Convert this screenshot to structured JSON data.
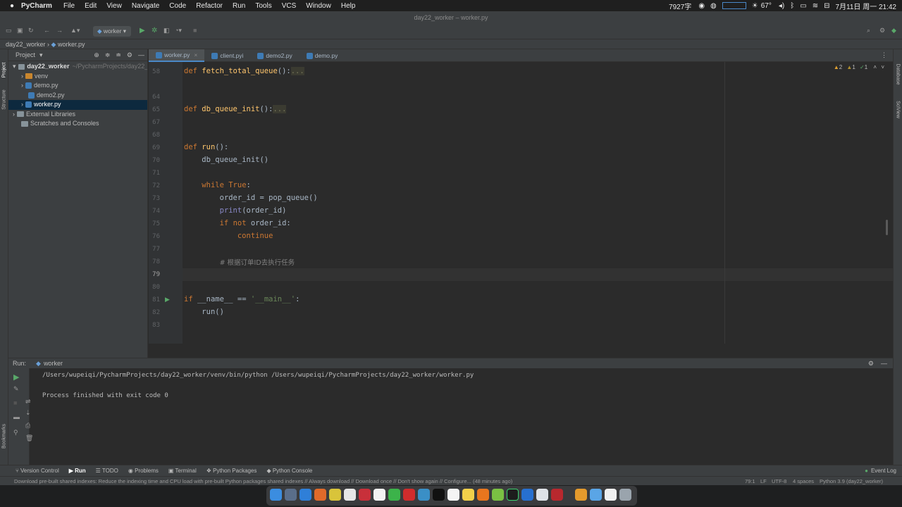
{
  "menubar": {
    "app": "PyCharm",
    "items": [
      "File",
      "Edit",
      "View",
      "Navigate",
      "Code",
      "Refactor",
      "Run",
      "Tools",
      "VCS",
      "Window",
      "Help"
    ],
    "status_count": "7927字",
    "temp": "67°",
    "datetime": "7月11日 周一 21:42"
  },
  "window": {
    "title": "day22_worker – worker.py"
  },
  "toolbar": {
    "run_config": "worker"
  },
  "nav": {
    "project": "day22_worker",
    "file": "worker.py"
  },
  "project_panel": {
    "title": "Project",
    "root": "day22_worker",
    "root_path": "~/PycharmProjects/day22_",
    "items": [
      "venv",
      "demo.py",
      "demo2.py",
      "worker.py",
      "External Libraries",
      "Scratches and Consoles"
    ]
  },
  "tabs": [
    "worker.py",
    "client.pyi",
    "demo2.py",
    "demo.py"
  ],
  "inspections": {
    "warnings": "2",
    "weak": "1",
    "typos": "1"
  },
  "code": {
    "l58": "58",
    "l64": "64",
    "l65": "65",
    "l67": "67",
    "l68": "68",
    "l69": "69",
    "l70": "70",
    "l71": "71",
    "l72": "72",
    "l73": "73",
    "l74": "74",
    "l75": "75",
    "l76": "76",
    "l77": "77",
    "l78": "78",
    "l79": "79",
    "l80": "80",
    "l81": "81",
    "l82": "82",
    "l83": "83",
    "def": "def",
    "while": "while",
    "true": "True",
    "if": "if",
    "not": "not",
    "continue": "continue",
    "eq": " == ",
    "fetch": "fetch_total_queue",
    "dbinit": "db_queue_init",
    "run": "run",
    "parens": "():",
    "dots": "...",
    "run_body": "db_queue_init()",
    "order_line": "order_id = pop_queue()",
    "print": "print",
    "print_arg": "(order_id)",
    "ifnot_arg": " order_id:",
    "comment": "# 根据订单ID去执行任务",
    "name_var": "__name__",
    "main_str": "'__main__'",
    "colon": ":",
    "run_call": "run()"
  },
  "run_panel": {
    "label": "Run:",
    "config": "worker",
    "cmd": "/Users/wupeiqi/PycharmProjects/day22_worker/venv/bin/python /Users/wupeiqi/PycharmProjects/day22_worker/worker.py",
    "result": "Process finished with exit code 0"
  },
  "bottom_tabs": [
    "Version Control",
    "Run",
    "TODO",
    "Problems",
    "Terminal",
    "Python Packages",
    "Python Console"
  ],
  "event_log": "Event Log",
  "status": {
    "message": "Download pre-built shared indexes: Reduce the indexing time and CPU load with pre-built Python packages shared indexes // Always download // Download once // Don't show again // Configure... (48 minutes ago)",
    "pos": "79:1",
    "lf": "LF",
    "enc": "UTF-8",
    "indent": "4 spaces",
    "interp": "Python 3.9 (day22_worker)"
  },
  "side_labels": {
    "project": "Project",
    "structure": "Structure",
    "bookmarks": "Bookmarks",
    "database": "Database",
    "sciview": "SciView"
  },
  "colors": {
    "bg": "#2b2b2b",
    "panel": "#3c3f41",
    "keyword": "#cc7832",
    "function": "#ffc66d",
    "string": "#6a8759",
    "accent": "#4a88c7"
  }
}
